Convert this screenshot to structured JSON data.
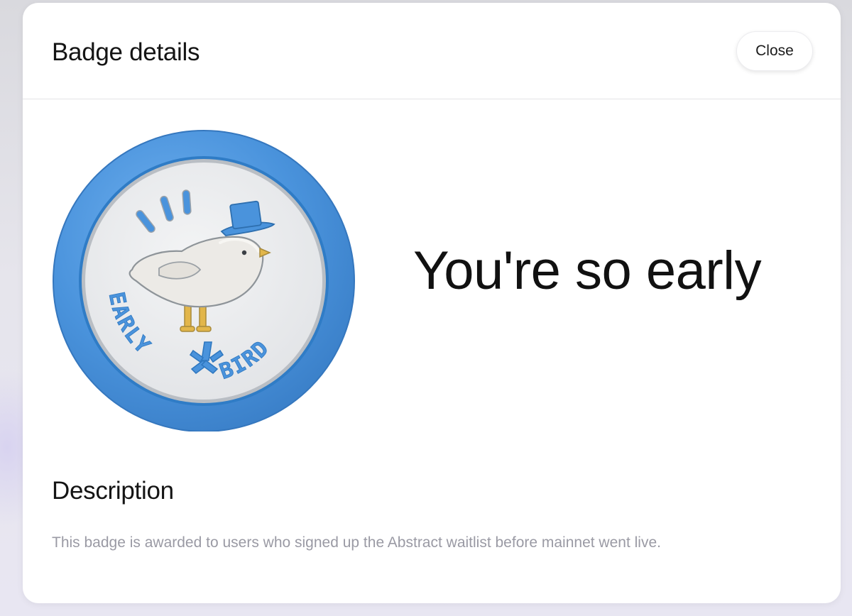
{
  "modal": {
    "title": "Badge details",
    "close_label": "Close"
  },
  "badge": {
    "name": "You're so early",
    "image": {
      "emblem_text_left": "EARLY",
      "emblem_text_right": "BIRD",
      "ring_color": "#4a93dc",
      "face_color": "#eceef0"
    }
  },
  "description": {
    "heading": "Description",
    "text": "This badge is awarded to users who signed up the Abstract waitlist before mainnet went live."
  }
}
